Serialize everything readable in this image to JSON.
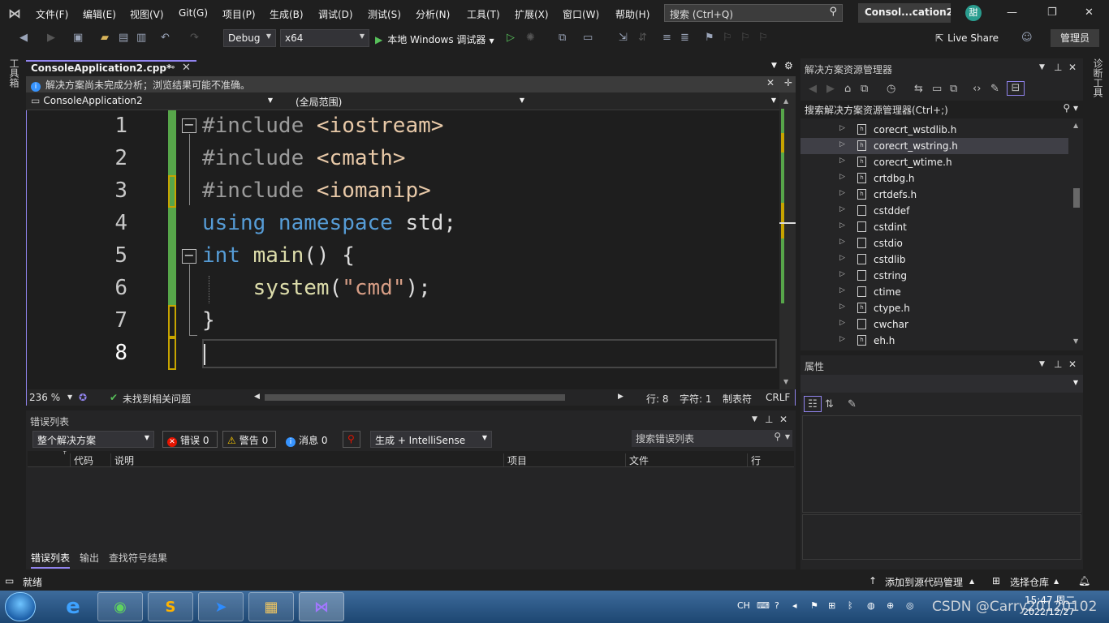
{
  "menu": {
    "items": [
      "文件(F)",
      "编辑(E)",
      "视图(V)",
      "Git(G)",
      "项目(P)",
      "生成(B)",
      "调试(D)",
      "测试(S)",
      "分析(N)",
      "工具(T)",
      "扩展(X)",
      "窗口(W)",
      "帮助(H)"
    ],
    "search_placeholder": "搜索 (Ctrl+Q)",
    "solution_title": "Consol...cation2",
    "user_initial": "甜"
  },
  "toolbar": {
    "config": "Debug",
    "platform": "x64",
    "run_label": "本地 Windows 调试器",
    "live_share": "Live Share",
    "admin": "管理员"
  },
  "left_rail": {
    "label": "工具箱"
  },
  "right_rail": {
    "label": "诊断工具"
  },
  "editor": {
    "tab_title": "ConsoleApplication2.cpp*",
    "info_message": "解决方案尚未完成分析；浏览结果可能不准确。",
    "nav_project": "ConsoleApplication2",
    "nav_scope": "(全局范围)",
    "lines": [
      {
        "n": "1",
        "parts": [
          [
            "kw-pre",
            "#include "
          ],
          [
            "hdr",
            "<iostream>"
          ]
        ]
      },
      {
        "n": "2",
        "parts": [
          [
            "kw-pre",
            "#include "
          ],
          [
            "hdr",
            "<cmath>"
          ]
        ]
      },
      {
        "n": "3",
        "parts": [
          [
            "kw-pre",
            "#include "
          ],
          [
            "hdr",
            "<iomanip>"
          ]
        ]
      },
      {
        "n": "4",
        "parts": [
          [
            "kw",
            "using "
          ],
          [
            "kw",
            "namespace "
          ],
          [
            "",
            "std;"
          ]
        ]
      },
      {
        "n": "5",
        "parts": [
          [
            "kw",
            "int "
          ],
          [
            "fn",
            "main"
          ],
          [
            "",
            "() {"
          ]
        ]
      },
      {
        "n": "6",
        "parts": [
          [
            "",
            "    "
          ],
          [
            "fn",
            "system"
          ],
          [
            "",
            "("
          ],
          [
            "str",
            "\"cmd\""
          ],
          [
            "",
            ");"
          ]
        ]
      },
      {
        "n": "7",
        "parts": [
          [
            "",
            "}"
          ]
        ]
      },
      {
        "n": "8",
        "parts": []
      }
    ],
    "status": {
      "zoom": "236 %",
      "issues": "未找到相关问题",
      "line": "行: 8",
      "char": "字符: 1",
      "tabs": "制表符",
      "eol": "CRLF"
    }
  },
  "error_list": {
    "title": "错误列表",
    "scope": "整个解决方案",
    "errors": "错误 0",
    "warnings": "警告 0",
    "messages": "消息 0",
    "source": "生成 + IntelliSense",
    "search_placeholder": "搜索错误列表",
    "columns": [
      "代码",
      "说明",
      "项目",
      "文件",
      "行"
    ],
    "bottom_tabs": [
      "错误列表",
      "输出",
      "查找符号结果"
    ]
  },
  "solution_explorer": {
    "title": "解决方案资源管理器",
    "search_placeholder": "搜索解决方案资源管理器(Ctrl+;)",
    "items": [
      {
        "label": "corecrt_wstdlib.h",
        "h": true
      },
      {
        "label": "corecrt_wstring.h",
        "h": true,
        "selected": true
      },
      {
        "label": "corecrt_wtime.h",
        "h": true
      },
      {
        "label": "crtdbg.h",
        "h": true
      },
      {
        "label": "crtdefs.h",
        "h": true
      },
      {
        "label": "cstddef",
        "h": false
      },
      {
        "label": "cstdint",
        "h": false
      },
      {
        "label": "cstdio",
        "h": false
      },
      {
        "label": "cstdlib",
        "h": false
      },
      {
        "label": "cstring",
        "h": false
      },
      {
        "label": "ctime",
        "h": false
      },
      {
        "label": "ctype.h",
        "h": true
      },
      {
        "label": "cwchar",
        "h": false
      },
      {
        "label": "eh.h",
        "h": true
      }
    ]
  },
  "properties": {
    "title": "属性"
  },
  "statusbar": {
    "ready": "就绪",
    "add_source": "添加到源代码管理",
    "select_repo": "选择仓库"
  },
  "taskbar": {
    "lang": "CH",
    "time": "15:47 周二",
    "date": "2022/12/27",
    "watermark": "CSDN @Carry20120102"
  },
  "colors": {
    "accent": "#9184ee",
    "change_green": "#57a64a",
    "change_yellow": "#c7a400",
    "keyword": "#569cd6",
    "function": "#dcdcaa",
    "string": "#d69d85"
  }
}
